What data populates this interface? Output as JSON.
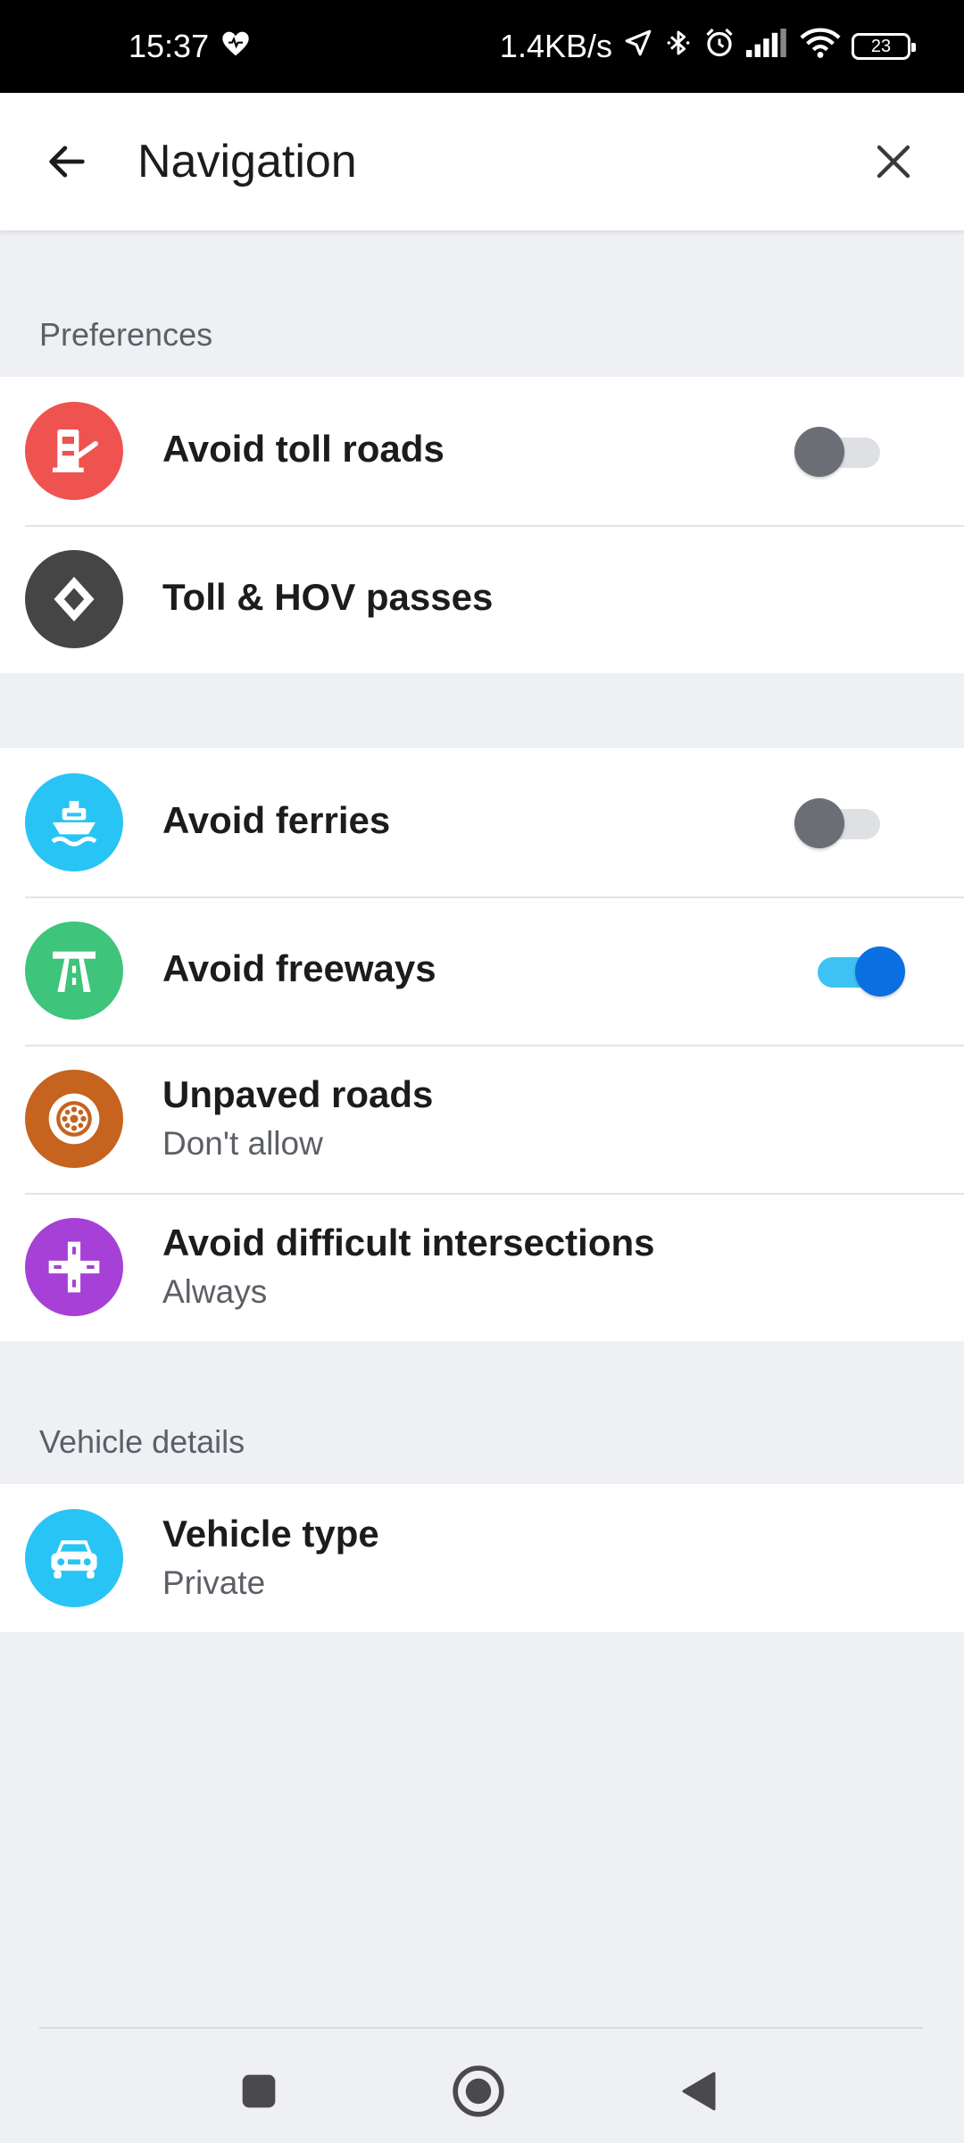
{
  "status_bar": {
    "time": "15:37",
    "network_speed": "1.4KB/s",
    "battery_level": "23",
    "icons": [
      "heart-icon",
      "location-arrow-icon",
      "bluetooth-icon",
      "alarm-icon",
      "signal-icon",
      "wifi-icon",
      "battery-icon"
    ]
  },
  "header": {
    "title": "Navigation",
    "back_icon": "arrow-left-icon",
    "close_icon": "close-icon"
  },
  "sections": {
    "preferences_label": "Preferences",
    "vehicle_details_label": "Vehicle details"
  },
  "rows": {
    "avoid_toll_roads": {
      "title": "Avoid toll roads",
      "icon": "toll-booth-icon",
      "icon_color": "#ef5350",
      "toggle_on": false
    },
    "toll_hov_passes": {
      "title": "Toll & HOV passes",
      "icon": "diamond-icon",
      "icon_color": "#454545"
    },
    "avoid_ferries": {
      "title": "Avoid ferries",
      "icon": "ferry-icon",
      "icon_color": "#29c4f6",
      "toggle_on": false
    },
    "avoid_freeways": {
      "title": "Avoid freeways",
      "icon": "freeway-icon",
      "icon_color": "#3ec47b",
      "toggle_on": true
    },
    "unpaved_roads": {
      "title": "Unpaved roads",
      "subtitle": "Don't allow",
      "icon": "wheel-icon",
      "icon_color": "#c5631f"
    },
    "avoid_difficult_intersections": {
      "title": "Avoid difficult intersections",
      "subtitle": "Always",
      "icon": "intersection-icon",
      "icon_color": "#a640d6"
    },
    "vehicle_type": {
      "title": "Vehicle type",
      "subtitle": "Private",
      "icon": "car-icon",
      "icon_color": "#29c4f6"
    }
  },
  "colors": {
    "toggle_on": "#0a6fe0",
    "toggle_track_on": "#3ec1f3",
    "toggle_off": "#6b6e75",
    "background": "#eff0f4"
  },
  "nav_bar": {
    "icons": [
      "recents-square-icon",
      "home-circle-icon",
      "back-triangle-icon"
    ]
  }
}
